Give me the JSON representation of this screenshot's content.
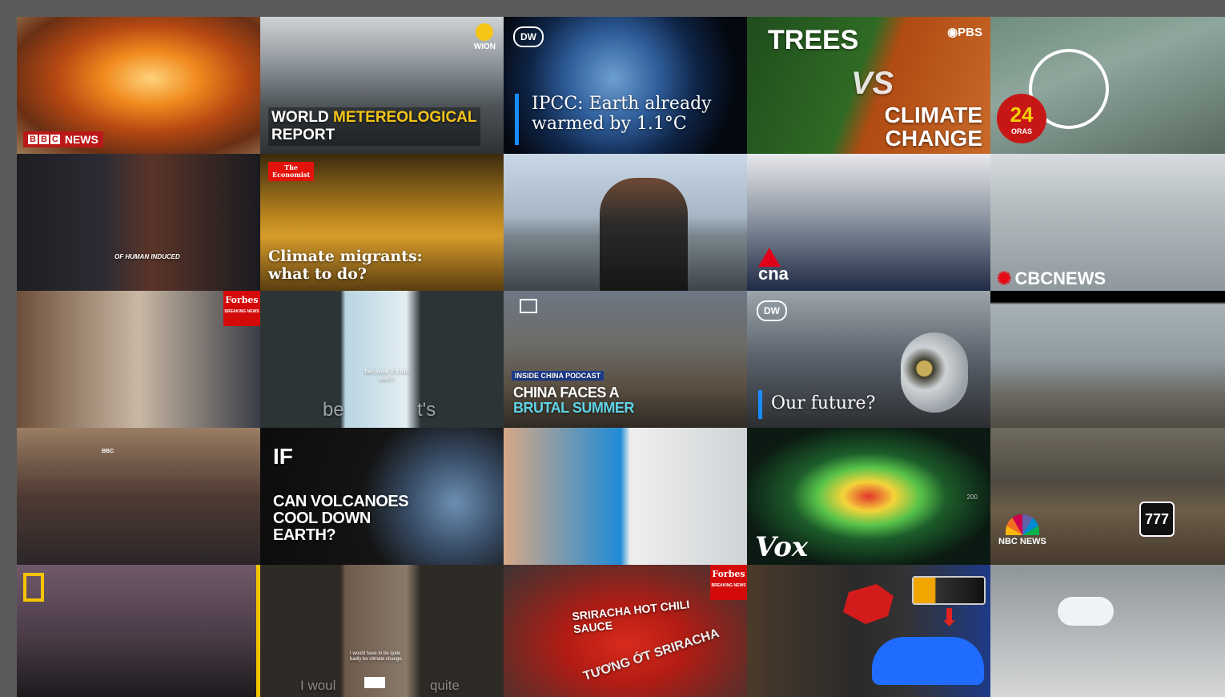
{
  "colors": {
    "selection": "#f0c419",
    "bbc_red": "#bb1919",
    "accent_blue": "#1a8cff",
    "forbes_red": "#d40a0a"
  },
  "tiles": [
    {
      "logo": "NEWS",
      "logo_boxes": [
        "B",
        "B",
        "C"
      ],
      "caption": ""
    },
    {
      "logo": "WION",
      "caption_line1_white": "WORLD ",
      "caption_line1_yellow": "METEREOLOGICAL",
      "caption_line2": "REPORT"
    },
    {
      "logo": "DW",
      "caption": "IPCC: Earth already warmed by 1.1°C"
    },
    {
      "logo": "PBS",
      "title_top": "TREES",
      "title_vs": "VS",
      "title_bottom1": "CLIMATE",
      "title_bottom2": "CHANGE"
    },
    {
      "logo": "24",
      "logo_sub": "ORAS"
    },
    {
      "caption": "OF HUMAN INDUCED"
    },
    {
      "logo_line1": "The",
      "logo_line2": "Economist",
      "caption": "Climate migrants: what to do?"
    },
    {
      "caption": ""
    },
    {
      "logo": "cna"
    },
    {
      "logo": "CBCNEWS"
    },
    {
      "logo_line1": "Forbes",
      "logo_line2": "BREAKING NEWS"
    },
    {
      "overlay": "because it's too warm",
      "caption": "be",
      "caption_right": "t's"
    },
    {
      "label": "INSIDE CHINA PODCAST",
      "caption_line1": "CHINA FACES A",
      "caption_line2": "BRUTAL SUMMER"
    },
    {
      "logo": "DW",
      "caption": "Our future?"
    },
    {
      "caption": ""
    },
    {
      "logo": "BBC"
    },
    {
      "logo": "IF",
      "caption_line1": "CAN VOLCANOES",
      "caption_line2": "COOL DOWN",
      "caption_line3": "EARTH?"
    },
    {
      "caption": ""
    },
    {
      "logo": "Vox",
      "axis_label": "200"
    },
    {
      "logo": "NBC NEWS",
      "sign_number": "777"
    },
    {
      "logo": ""
    },
    {
      "caption_left": "I woul",
      "caption_right": "quite",
      "subtitle": "I would have to be quite badly be climate change."
    },
    {
      "logo_line1": "Forbes",
      "logo_line2": "BREAKING NEWS",
      "bottle_text": "SRIRACHA HOT CHILI SAUCE",
      "bottle_viet": "TƯƠNG ỚT SRIRACHA"
    },
    {
      "caption": ""
    },
    {
      "caption": ""
    }
  ]
}
